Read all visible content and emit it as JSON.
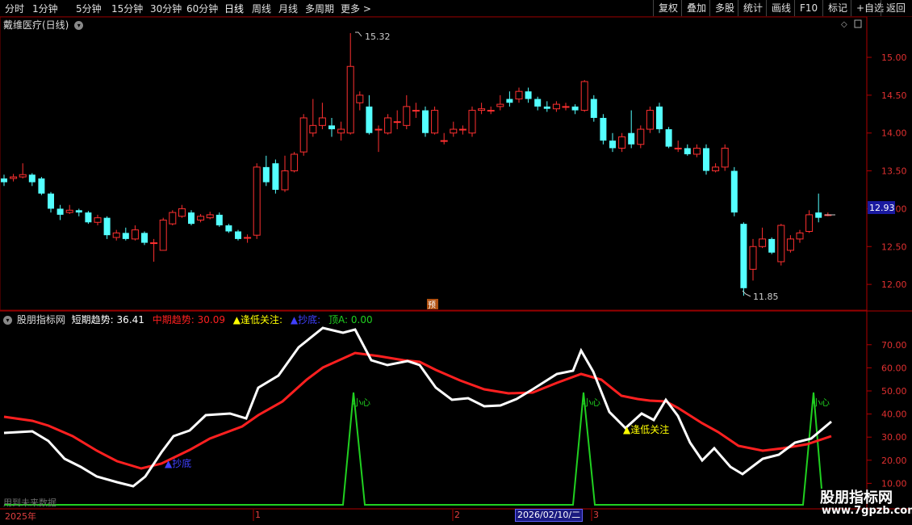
{
  "toolbar": {
    "periods": [
      "分时",
      "1分钟",
      "5分钟",
      "15分钟",
      "30分钟",
      "60分钟",
      "日线",
      "周线",
      "月线",
      "多周期",
      "更多 >"
    ],
    "actions": [
      "复权",
      "叠加",
      "多股",
      "统计",
      "画线",
      "F10",
      "标记",
      "+自选",
      "返回"
    ]
  },
  "stock": {
    "title": "戴维医疗(日线)",
    "high_label": "15.32",
    "low_label": "11.85",
    "current_price": "12.93",
    "forecast_tag": "预",
    "price_axis": [
      "15.00",
      "14.50",
      "14.00",
      "13.50",
      "13.00",
      "12.50",
      "12.00"
    ]
  },
  "indicator": {
    "name": "股朋指标网",
    "short_label": "短期趋势:",
    "short_value": "36.41",
    "mid_label": "中期趋势:",
    "mid_value": "30.09",
    "low_attention": "▲逢低关注:",
    "bottom": "▲抄底:",
    "top_label": "顶A:",
    "top_value": "0.00",
    "axis": [
      "70.00",
      "60.00",
      "50.00",
      "40.00",
      "30.00",
      "20.00",
      "10.00"
    ],
    "annotations": {
      "caution": "小心",
      "low_attention": "▲逢低关注",
      "bottom": "▲抄底"
    },
    "future_note": "用到未来数据"
  },
  "datebar": {
    "year": "2025年",
    "month1": "1",
    "month2": "2",
    "month3": "3",
    "cursor_date": "2026/02/10/二"
  },
  "watermark": {
    "brand": "股朋指标网",
    "url": "www.7gpzb.com"
  },
  "colors": {
    "up": "#ff3030",
    "down": "#54ffff",
    "short": "#ffffff",
    "mid": "#ff2020",
    "top": "#20d020",
    "low_attention": "#ffff00",
    "bottom": "#4040ff"
  }
}
